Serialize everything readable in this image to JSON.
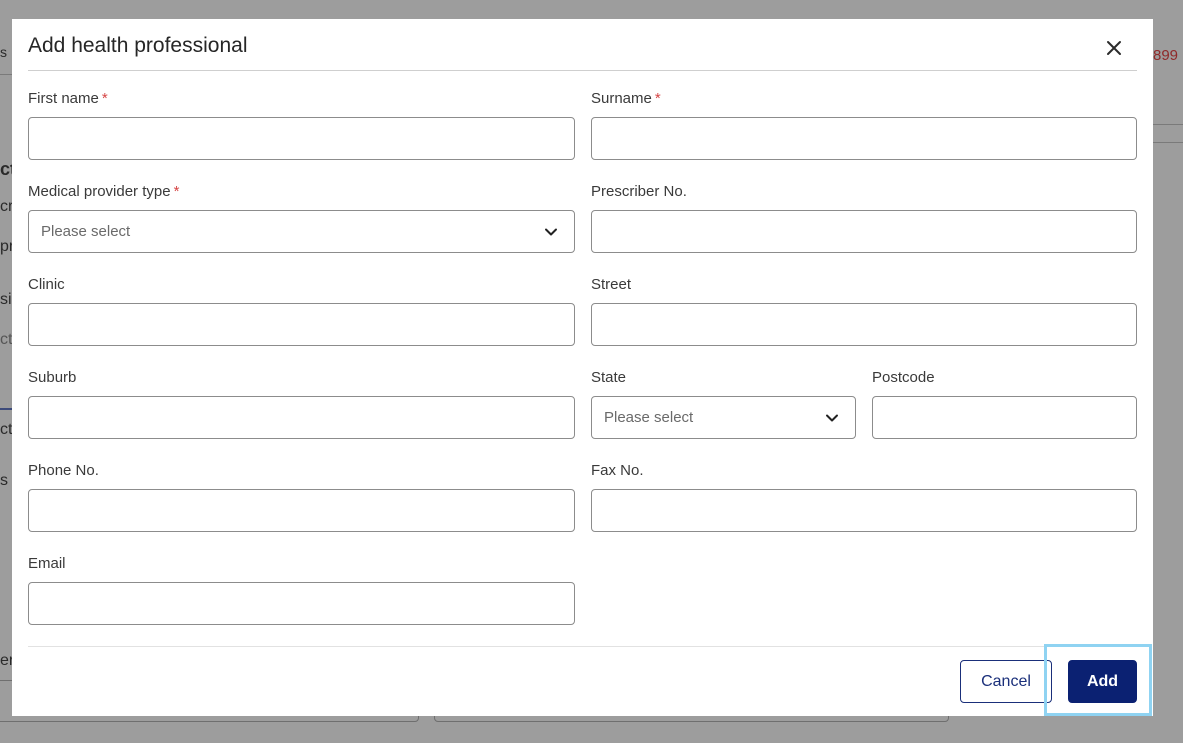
{
  "background": {
    "fragments": [
      "ct",
      "cr",
      "pr",
      "si",
      "ct",
      "ct",
      "s",
      "er"
    ],
    "red_number": "899"
  },
  "modal": {
    "title": "Add health professional",
    "close_icon": "close-icon",
    "fields": {
      "first_name": {
        "label": "First name",
        "required": "*",
        "value": ""
      },
      "surname": {
        "label": "Surname",
        "required": "*",
        "value": ""
      },
      "provider_type": {
        "label": "Medical provider type",
        "required": "*",
        "selected": "Please select"
      },
      "prescriber_no": {
        "label": "Prescriber No.",
        "value": ""
      },
      "clinic": {
        "label": "Clinic",
        "value": ""
      },
      "street": {
        "label": "Street",
        "value": ""
      },
      "suburb": {
        "label": "Suburb",
        "value": ""
      },
      "state": {
        "label": "State",
        "selected": "Please select"
      },
      "postcode": {
        "label": "Postcode",
        "value": ""
      },
      "phone": {
        "label": "Phone No.",
        "value": ""
      },
      "fax": {
        "label": "Fax No.",
        "value": ""
      },
      "email": {
        "label": "Email",
        "value": ""
      }
    },
    "buttons": {
      "cancel": "Cancel",
      "add": "Add"
    }
  },
  "colors": {
    "primary": "#0b2172",
    "required": "#d64545",
    "focus": "#8fd3f2",
    "overlay": "#9d9d9d"
  }
}
